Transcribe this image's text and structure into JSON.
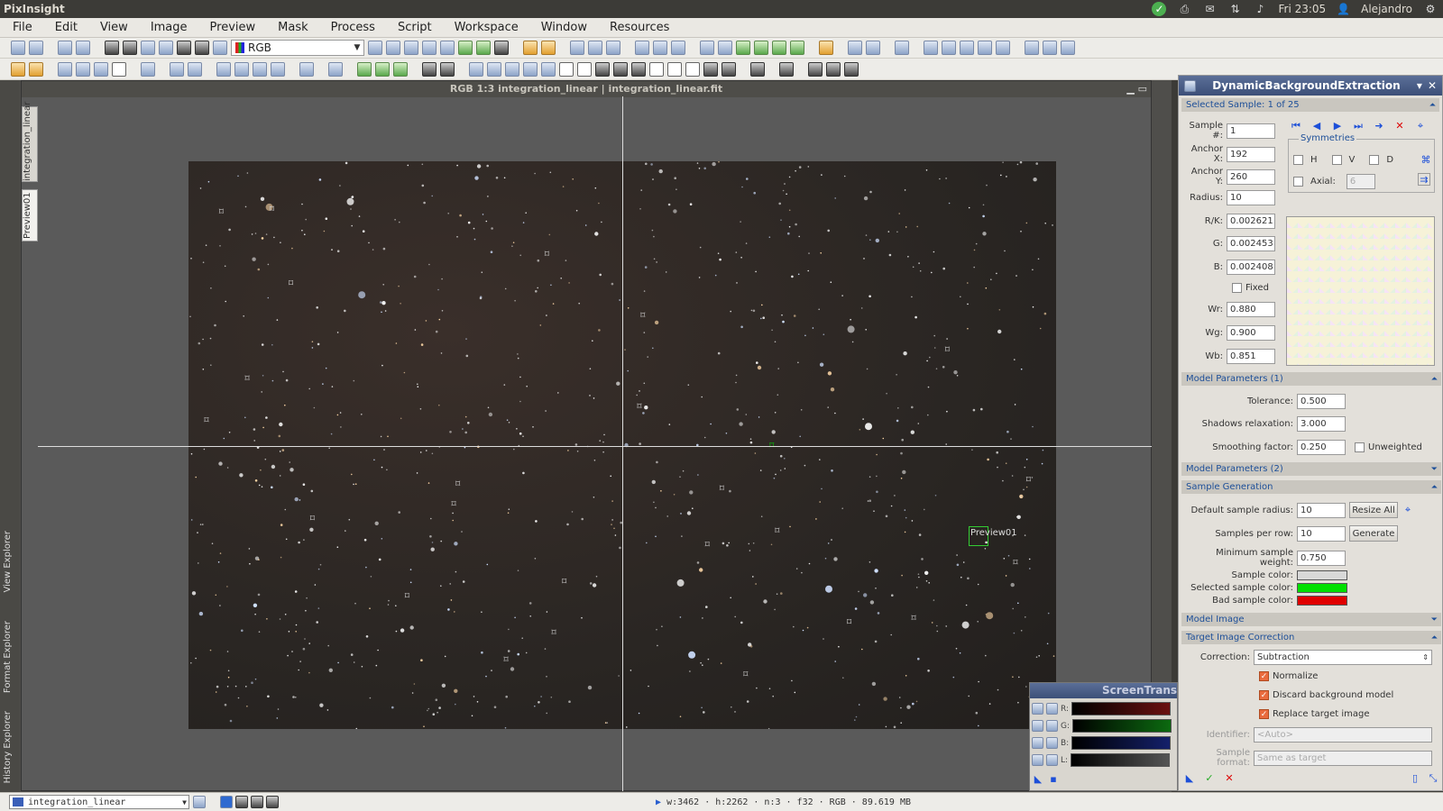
{
  "topbar": {
    "app_name": "PixInsight",
    "clock": "Fri 23:05",
    "user": "Alejandro"
  },
  "menu": [
    "File",
    "Edit",
    "View",
    "Image",
    "Preview",
    "Mask",
    "Process",
    "Script",
    "Workspace",
    "Window",
    "Resources"
  ],
  "toolbar": {
    "rgb_combo": "RGB"
  },
  "image_window": {
    "title": "RGB 1:3 integration_linear | integration_linear.fit",
    "preview_label": "Preview01"
  },
  "view_tabs": [
    "integration_linear",
    "Preview01"
  ],
  "left_explorers": [
    "View Explorer",
    "Format Explorer",
    "History Explorer"
  ],
  "dbe": {
    "title": "DynamicBackgroundExtraction",
    "selected_sample_section": "Selected Sample: 1 of 25",
    "sample_num_label": "Sample #:",
    "sample_num": "1",
    "anchor_x_label": "Anchor X:",
    "anchor_x": "192",
    "anchor_y_label": "Anchor Y:",
    "anchor_y": "260",
    "radius_label": "Radius:",
    "radius": "10",
    "symmetries_label": "Symmetries",
    "sym_h": "H",
    "sym_v": "V",
    "sym_d": "D",
    "axial_label": "Axial:",
    "axial_value": "6",
    "rk_label": "R/K:",
    "rk": "0.002621",
    "g_label": "G:",
    "g": "0.002453",
    "b_label": "B:",
    "b": "0.002408",
    "fixed_label": "Fixed",
    "wr_label": "Wr:",
    "wr": "0.880",
    "wg_label": "Wg:",
    "wg": "0.900",
    "wb_label": "Wb:",
    "wb": "0.851",
    "model_params1": "Model Parameters (1)",
    "tolerance_label": "Tolerance:",
    "tolerance": "0.500",
    "shadows_label": "Shadows relaxation:",
    "shadows": "3.000",
    "smoothing_label": "Smoothing factor:",
    "smoothing": "0.250",
    "unweighted_label": "Unweighted",
    "model_params2": "Model Parameters (2)",
    "sample_gen": "Sample Generation",
    "default_radius_label": "Default sample radius:",
    "default_radius": "10",
    "resize_all": "Resize All",
    "samples_per_row_label": "Samples per row:",
    "samples_per_row": "10",
    "generate": "Generate",
    "min_weight_label": "Minimum sample weight:",
    "min_weight": "0.750",
    "sample_color_label": "Sample color:",
    "selected_color_label": "Selected sample color:",
    "bad_color_label": "Bad sample color:",
    "model_image": "Model Image",
    "target_correction": "Target Image Correction",
    "correction_label": "Correction:",
    "correction": "Subtraction",
    "normalize_label": "Normalize",
    "discard_label": "Discard background model",
    "replace_label": "Replace target image",
    "identifier_label": "Identifier:",
    "identifier_placeholder": "<Auto>",
    "sample_format_label": "Sample format:",
    "sample_format": "Same as target"
  },
  "colors": {
    "sample": "#d8d8d8",
    "selected_sample": "#00e000",
    "bad_sample": "#e00000"
  },
  "stf": {
    "title": "ScreenTransfe",
    "r": "R:",
    "g": "G:",
    "b": "B:",
    "l": "L:"
  },
  "statusbar": {
    "view": "integration_linear",
    "info": "w:3462 · h:2262 · n:3 · f32 · RGB · 89.619 MB"
  }
}
